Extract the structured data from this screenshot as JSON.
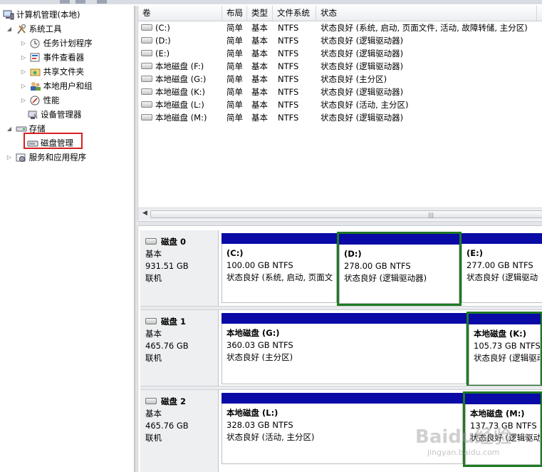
{
  "tree": {
    "root": "计算机管理(本地)",
    "items": [
      {
        "label": "系统工具",
        "icon": "tools-icon"
      },
      {
        "label": "任务计划程序",
        "icon": "clock-icon"
      },
      {
        "label": "事件查看器",
        "icon": "event-viewer-icon"
      },
      {
        "label": "共享文件夹",
        "icon": "shared-folder-icon"
      },
      {
        "label": "本地用户和组",
        "icon": "users-icon"
      },
      {
        "label": "性能",
        "icon": "performance-icon"
      },
      {
        "label": "设备管理器",
        "icon": "device-manager-icon"
      },
      {
        "label": "存储",
        "icon": "storage-icon"
      },
      {
        "label": "磁盘管理",
        "icon": "disk-management-icon"
      },
      {
        "label": "服务和应用程序",
        "icon": "services-icon"
      }
    ]
  },
  "volumes": {
    "headers": [
      "卷",
      "布局",
      "类型",
      "文件系统",
      "状态"
    ],
    "rows": [
      {
        "vol": "(C:)",
        "layout": "简单",
        "type": "基本",
        "fs": "NTFS",
        "status": "状态良好 (系统, 启动, 页面文件, 活动, 故障转储, 主分区)"
      },
      {
        "vol": "(D:)",
        "layout": "简单",
        "type": "基本",
        "fs": "NTFS",
        "status": "状态良好 (逻辑驱动器)"
      },
      {
        "vol": "(E:)",
        "layout": "简单",
        "type": "基本",
        "fs": "NTFS",
        "status": "状态良好 (逻辑驱动器)"
      },
      {
        "vol": "本地磁盘 (F:)",
        "layout": "简单",
        "type": "基本",
        "fs": "NTFS",
        "status": "状态良好 (逻辑驱动器)"
      },
      {
        "vol": "本地磁盘 (G:)",
        "layout": "简单",
        "type": "基本",
        "fs": "NTFS",
        "status": "状态良好 (主分区)"
      },
      {
        "vol": "本地磁盘 (K:)",
        "layout": "简单",
        "type": "基本",
        "fs": "NTFS",
        "status": "状态良好 (逻辑驱动器)"
      },
      {
        "vol": "本地磁盘 (L:)",
        "layout": "简单",
        "type": "基本",
        "fs": "NTFS",
        "status": "状态良好 (活动, 主分区)"
      },
      {
        "vol": "本地磁盘 (M:)",
        "layout": "简单",
        "type": "基本",
        "fs": "NTFS",
        "status": "状态良好 (逻辑驱动器)"
      }
    ]
  },
  "disks": [
    {
      "name": "磁盘 0",
      "kind": "基本",
      "size": "931.51 GB",
      "state": "联机",
      "partitions": [
        {
          "name": "(C:)",
          "size": "100.00 GB NTFS",
          "status": "状态良好 (系统, 启动, 页面文"
        },
        {
          "name": "(D:)",
          "size": "278.00 GB NTFS",
          "status": "状态良好 (逻辑驱动器)"
        },
        {
          "name": "(E:)",
          "size": "277.00 GB NTFS",
          "status": "状态良好 (逻辑驱动"
        }
      ]
    },
    {
      "name": "磁盘 1",
      "kind": "基本",
      "size": "465.76 GB",
      "state": "联机",
      "partitions": [
        {
          "name": "本地磁盘  (G:)",
          "size": "360.03 GB NTFS",
          "status": "状态良好 (主分区)"
        },
        {
          "name": "本地磁盘  (K:)",
          "size": "105.73 GB NTFS",
          "status": "状态良好 (逻辑驱动"
        }
      ]
    },
    {
      "name": "磁盘 2",
      "kind": "基本",
      "size": "465.76 GB",
      "state": "联机",
      "partitions": [
        {
          "name": "本地磁盘  (L:)",
          "size": "328.03 GB NTFS",
          "status": "状态良好 (活动, 主分区)"
        },
        {
          "name": "本地磁盘  (M:)",
          "size": "137.73 GB NTFS",
          "status": "状态良好 (逻辑驱动"
        }
      ]
    }
  ],
  "watermark": {
    "logo": "Baidu经验",
    "url": "jingyan.baidu.com"
  },
  "colors": {
    "partition_bar": "#0a0aa6",
    "selected_border": "#1d7b24",
    "highlight_box": "#d82020"
  }
}
